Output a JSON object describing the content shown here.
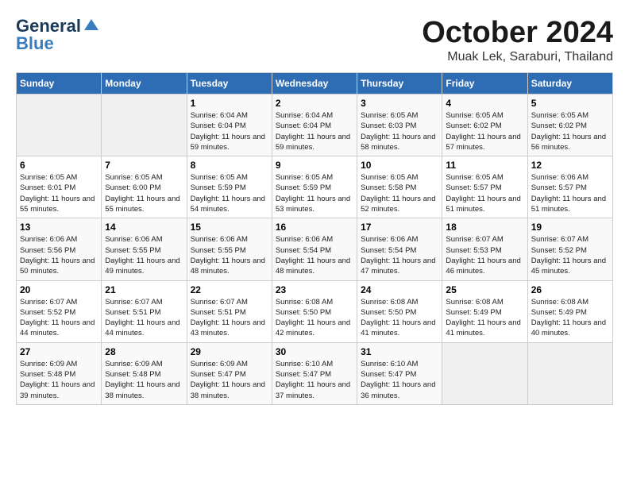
{
  "logo": {
    "general": "General",
    "blue": "Blue"
  },
  "header": {
    "month": "October 2024",
    "location": "Muak Lek, Saraburi, Thailand"
  },
  "weekdays": [
    "Sunday",
    "Monday",
    "Tuesday",
    "Wednesday",
    "Thursday",
    "Friday",
    "Saturday"
  ],
  "weeks": [
    [
      {
        "day": "",
        "info": ""
      },
      {
        "day": "",
        "info": ""
      },
      {
        "day": "1",
        "info": "Sunrise: 6:04 AM\nSunset: 6:04 PM\nDaylight: 11 hours and 59 minutes."
      },
      {
        "day": "2",
        "info": "Sunrise: 6:04 AM\nSunset: 6:04 PM\nDaylight: 11 hours and 59 minutes."
      },
      {
        "day": "3",
        "info": "Sunrise: 6:05 AM\nSunset: 6:03 PM\nDaylight: 11 hours and 58 minutes."
      },
      {
        "day": "4",
        "info": "Sunrise: 6:05 AM\nSunset: 6:02 PM\nDaylight: 11 hours and 57 minutes."
      },
      {
        "day": "5",
        "info": "Sunrise: 6:05 AM\nSunset: 6:02 PM\nDaylight: 11 hours and 56 minutes."
      }
    ],
    [
      {
        "day": "6",
        "info": "Sunrise: 6:05 AM\nSunset: 6:01 PM\nDaylight: 11 hours and 55 minutes."
      },
      {
        "day": "7",
        "info": "Sunrise: 6:05 AM\nSunset: 6:00 PM\nDaylight: 11 hours and 55 minutes."
      },
      {
        "day": "8",
        "info": "Sunrise: 6:05 AM\nSunset: 5:59 PM\nDaylight: 11 hours and 54 minutes."
      },
      {
        "day": "9",
        "info": "Sunrise: 6:05 AM\nSunset: 5:59 PM\nDaylight: 11 hours and 53 minutes."
      },
      {
        "day": "10",
        "info": "Sunrise: 6:05 AM\nSunset: 5:58 PM\nDaylight: 11 hours and 52 minutes."
      },
      {
        "day": "11",
        "info": "Sunrise: 6:05 AM\nSunset: 5:57 PM\nDaylight: 11 hours and 51 minutes."
      },
      {
        "day": "12",
        "info": "Sunrise: 6:06 AM\nSunset: 5:57 PM\nDaylight: 11 hours and 51 minutes."
      }
    ],
    [
      {
        "day": "13",
        "info": "Sunrise: 6:06 AM\nSunset: 5:56 PM\nDaylight: 11 hours and 50 minutes."
      },
      {
        "day": "14",
        "info": "Sunrise: 6:06 AM\nSunset: 5:55 PM\nDaylight: 11 hours and 49 minutes."
      },
      {
        "day": "15",
        "info": "Sunrise: 6:06 AM\nSunset: 5:55 PM\nDaylight: 11 hours and 48 minutes."
      },
      {
        "day": "16",
        "info": "Sunrise: 6:06 AM\nSunset: 5:54 PM\nDaylight: 11 hours and 48 minutes."
      },
      {
        "day": "17",
        "info": "Sunrise: 6:06 AM\nSunset: 5:54 PM\nDaylight: 11 hours and 47 minutes."
      },
      {
        "day": "18",
        "info": "Sunrise: 6:07 AM\nSunset: 5:53 PM\nDaylight: 11 hours and 46 minutes."
      },
      {
        "day": "19",
        "info": "Sunrise: 6:07 AM\nSunset: 5:52 PM\nDaylight: 11 hours and 45 minutes."
      }
    ],
    [
      {
        "day": "20",
        "info": "Sunrise: 6:07 AM\nSunset: 5:52 PM\nDaylight: 11 hours and 44 minutes."
      },
      {
        "day": "21",
        "info": "Sunrise: 6:07 AM\nSunset: 5:51 PM\nDaylight: 11 hours and 44 minutes."
      },
      {
        "day": "22",
        "info": "Sunrise: 6:07 AM\nSunset: 5:51 PM\nDaylight: 11 hours and 43 minutes."
      },
      {
        "day": "23",
        "info": "Sunrise: 6:08 AM\nSunset: 5:50 PM\nDaylight: 11 hours and 42 minutes."
      },
      {
        "day": "24",
        "info": "Sunrise: 6:08 AM\nSunset: 5:50 PM\nDaylight: 11 hours and 41 minutes."
      },
      {
        "day": "25",
        "info": "Sunrise: 6:08 AM\nSunset: 5:49 PM\nDaylight: 11 hours and 41 minutes."
      },
      {
        "day": "26",
        "info": "Sunrise: 6:08 AM\nSunset: 5:49 PM\nDaylight: 11 hours and 40 minutes."
      }
    ],
    [
      {
        "day": "27",
        "info": "Sunrise: 6:09 AM\nSunset: 5:48 PM\nDaylight: 11 hours and 39 minutes."
      },
      {
        "day": "28",
        "info": "Sunrise: 6:09 AM\nSunset: 5:48 PM\nDaylight: 11 hours and 38 minutes."
      },
      {
        "day": "29",
        "info": "Sunrise: 6:09 AM\nSunset: 5:47 PM\nDaylight: 11 hours and 38 minutes."
      },
      {
        "day": "30",
        "info": "Sunrise: 6:10 AM\nSunset: 5:47 PM\nDaylight: 11 hours and 37 minutes."
      },
      {
        "day": "31",
        "info": "Sunrise: 6:10 AM\nSunset: 5:47 PM\nDaylight: 11 hours and 36 minutes."
      },
      {
        "day": "",
        "info": ""
      },
      {
        "day": "",
        "info": ""
      }
    ]
  ]
}
